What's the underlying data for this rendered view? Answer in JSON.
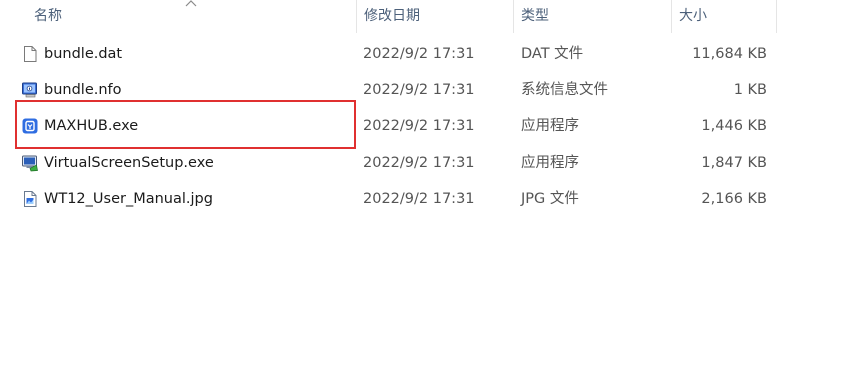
{
  "columns": {
    "name": "名称",
    "modified": "修改日期",
    "type": "类型",
    "size": "大小"
  },
  "files": [
    {
      "name": "bundle.dat",
      "modified": "2022/9/2 17:31",
      "type": "DAT 文件",
      "size": "11,684 KB",
      "icon": "blank-file-icon"
    },
    {
      "name": "bundle.nfo",
      "modified": "2022/9/2 17:31",
      "type": "系统信息文件",
      "size": "1 KB",
      "icon": "system-info-icon"
    },
    {
      "name": "MAXHUB.exe",
      "modified": "2022/9/2 17:31",
      "type": "应用程序",
      "size": "1,446 KB",
      "icon": "maxhub-app-icon",
      "highlighted": true
    },
    {
      "name": "VirtualScreenSetup.exe",
      "modified": "2022/9/2 17:31",
      "type": "应用程序",
      "size": "1,847 KB",
      "icon": "installer-icon"
    },
    {
      "name": "WT12_User_Manual.jpg",
      "modified": "2022/9/2 17:31",
      "type": "JPG 文件",
      "size": "2,166 KB",
      "icon": "image-file-icon"
    }
  ],
  "colors": {
    "highlight": "#e03030",
    "header_text": "#4c607a",
    "app_blue": "#2f6de1"
  }
}
